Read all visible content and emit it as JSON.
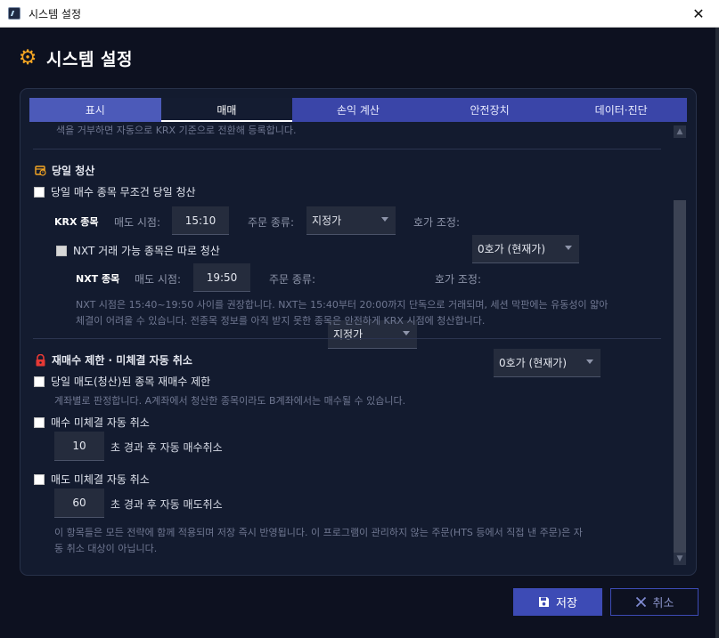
{
  "window": {
    "title": "시스템 설정",
    "close_glyph": "✕"
  },
  "header": {
    "title": "시스템 설정",
    "icon": "gear-icon"
  },
  "tabs": [
    {
      "label": "표시"
    },
    {
      "label": "매매"
    },
    {
      "label": "손익 계산"
    },
    {
      "label": "안전장치"
    },
    {
      "label": "데이터·진단"
    }
  ],
  "active_tab": "매매",
  "top_hint": "색을 거부하면 자동으로 KRX 기준으로 전환해 등록합니다.",
  "eod": {
    "title": "당일 청산",
    "unconditional_label": "당일 매수 종목 무조건 당일 청산",
    "unconditional_checked": false,
    "krx": {
      "label": "KRX 종목",
      "sell_time_label": "매도 시점:",
      "sell_time": "15:10",
      "order_type_label": "주문 종류:",
      "order_type": "지정가",
      "tick_label": "호가 조정:",
      "tick": "0호가 (현재가)"
    },
    "nxt_separate_label": "NXT 거래 가능 종목은 따로 청산",
    "nxt_separate_checked": false,
    "nxt": {
      "label": "NXT 종목",
      "sell_time_label": "매도 시점:",
      "sell_time": "19:50",
      "order_type_label": "주문 종류:",
      "order_type": "지정가",
      "tick_label": "호가 조정:",
      "tick": "0호가 (현재가)"
    },
    "nxt_hint_line1": "NXT 시점은 15:40~19:50 사이를 권장합니다. NXT는 15:40부터 20:00까지 단독으로 거래되며, 세션 막판에는 유동성이 얇아",
    "nxt_hint_line2": "체결이 어려울 수 있습니다. 전종목 정보를 아직 받지 못한 종목은 안전하게 KRX 시점에 청산합니다."
  },
  "rebuy": {
    "title": "재매수 제한 · 미체결 자동 취소",
    "rebuy_limit_label": "당일 매도(청산)된 종목 재매수 제한",
    "rebuy_limit_checked": false,
    "rebuy_hint": "계좌별로 판정합니다. A계좌에서 청산한 종목이라도 B계좌에서는 매수될 수 있습니다.",
    "buy_cancel_label": "매수 미체결 자동 취소",
    "buy_cancel_checked": false,
    "buy_cancel_seconds": "10",
    "buy_cancel_suffix": "초 경과 후 자동 매수취소",
    "sell_cancel_label": "매도 미체결 자동 취소",
    "sell_cancel_checked": false,
    "sell_cancel_seconds": "60",
    "sell_cancel_suffix": "초 경과 후 자동 매도취소",
    "footer_hint_line1": "이 항목들은 모든 전략에 함께 적용되며 저장 즉시 반영됩니다. 이 프로그램이 관리하지 않는 주문(HTS 등에서 직접 낸 주문)은 자",
    "footer_hint_line2": "동 취소 대상이 아닙니다."
  },
  "buttons": {
    "save": "저장",
    "cancel": "취소"
  },
  "colors": {
    "accent": "#3d4bb5",
    "gear": "#f5a623",
    "lock": "#e53935",
    "background": "#0d1120"
  }
}
